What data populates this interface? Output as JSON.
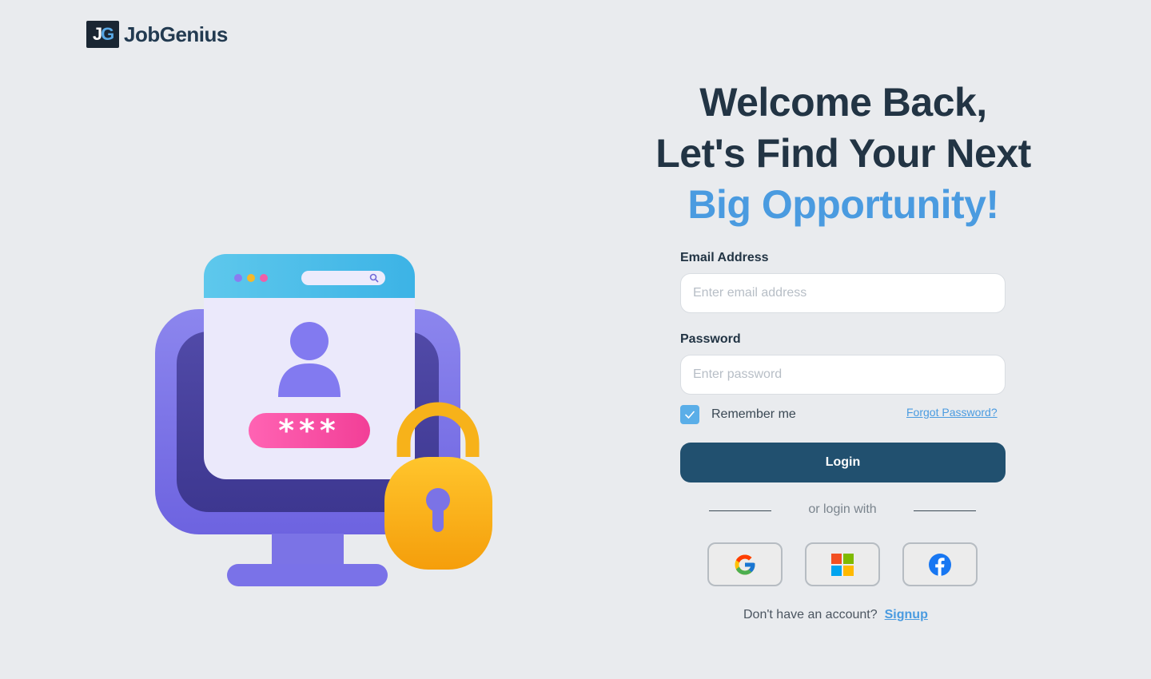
{
  "brand": {
    "logo_mark": "JG",
    "name": "JobGenius"
  },
  "headline": {
    "line1": "Welcome Back,",
    "line2": "Let's Find Your Next",
    "line3": "Big Opportunity!"
  },
  "form": {
    "email_label": "Email Address",
    "email_placeholder": "Enter email address",
    "email_value": "",
    "password_label": "Password",
    "password_placeholder": "Enter password",
    "password_value": "",
    "remember_label": "Remember me",
    "remember_checked": true,
    "forgot_label": "Forgot Password?",
    "login_label": "Login"
  },
  "social": {
    "divider_text": "or login with",
    "providers": [
      {
        "name": "Google",
        "icon": "google-icon"
      },
      {
        "name": "Microsoft",
        "icon": "microsoft-icon"
      },
      {
        "name": "Facebook",
        "icon": "facebook-icon"
      }
    ]
  },
  "signup": {
    "prompt": "Don't have an account?",
    "link": "Signup"
  },
  "illustration": {
    "password_mask": "***"
  },
  "colors": {
    "background": "#e9ebee",
    "primary": "#21506f",
    "accent": "#4a9be0",
    "heading": "#223444"
  }
}
